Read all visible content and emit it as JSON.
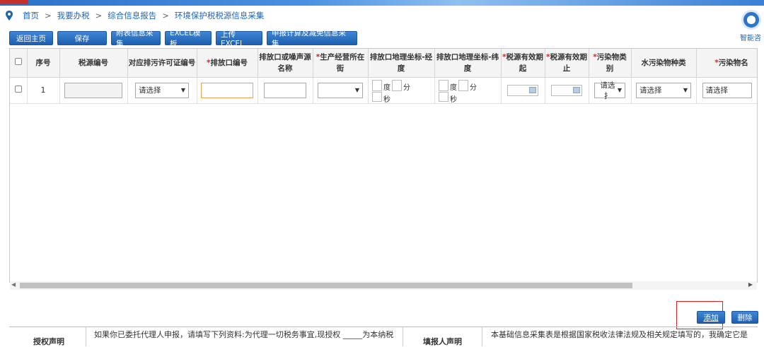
{
  "breadcrumb": [
    "首页",
    "我要办税",
    "综合信息报告",
    "环境保护税税源信息采集"
  ],
  "breadcrumb_sep": ">",
  "assistant": {
    "label": "智能咨",
    "icon": "customer-service-icon"
  },
  "toolbar": {
    "back": "返回主页",
    "save": "保存",
    "attach": "附表信息采集",
    "excel_template": "EXCEL模板",
    "upload_excel": "上传EXCEL",
    "declare": "申报计算及减免信息采集"
  },
  "columns": {
    "seq": "序号",
    "tax_source_no": "税源编号",
    "permit_no": "对应排污许可证编号",
    "outlet_no": "排放口编号",
    "outlet_name": "排放口或噪声源名称",
    "address": "生产经营所在街",
    "lng": "排放口地理坐标-经度",
    "lat": "排放口地理坐标-纬度",
    "valid_from": "税源有效期起",
    "valid_to": "税源有效期止",
    "pollutant_cat": "污染物类别",
    "water_type": "水污染物种类",
    "pollutant_name": "污染物名"
  },
  "row": {
    "seq": "1",
    "permit_select": "请选择",
    "cat_select": "请选扌",
    "water_select": "请选择",
    "name_select": "请选择",
    "deg": "度",
    "min": "分",
    "sec": "秒"
  },
  "actions": {
    "add": "添加",
    "delete": "删除"
  },
  "footer": {
    "auth_title": "授权声明",
    "auth_text": "如果你已委托代理人申报，请填写下列资料:为代理一切税务事宜,现授权 _____为本纳税",
    "filler_title": "填报人声明",
    "filler_text": "本基础信息采集表是根据国家税收法律法规及相关规定填写的，我确定它是"
  },
  "colors": {
    "primary": "#1f63b5",
    "required": "#e02020",
    "highlight": "#e02020"
  }
}
